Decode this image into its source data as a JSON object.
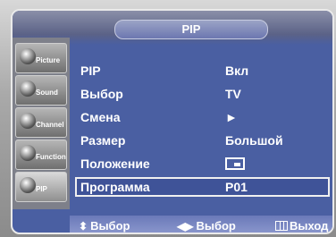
{
  "menu": {
    "title": "PIP",
    "rows": [
      {
        "label": "PIP",
        "value": "Вкл"
      },
      {
        "label": "Выбор",
        "value": "TV"
      },
      {
        "label": "Смена",
        "value": "►"
      },
      {
        "label": "Размер",
        "value": "Большой"
      },
      {
        "label": "Положение",
        "value": ""
      },
      {
        "label": "Программа",
        "value": "P01"
      }
    ],
    "selected_row": 5
  },
  "sidebar": {
    "items": [
      {
        "label": "Picture",
        "icon": "picture-icon"
      },
      {
        "label": "Sound",
        "icon": "sound-icon"
      },
      {
        "label": "Channel",
        "icon": "channel-icon"
      },
      {
        "label": "Function",
        "icon": "function-icon"
      },
      {
        "label": "PIP",
        "icon": "pip-icon"
      }
    ]
  },
  "footer": {
    "move_label": "Выбор",
    "select_label": "Выбор",
    "exit_label": "Выход"
  },
  "colors": {
    "osd_background": "#4a5fa2",
    "sidebar": "#7e808a",
    "text": "#ffffff"
  }
}
